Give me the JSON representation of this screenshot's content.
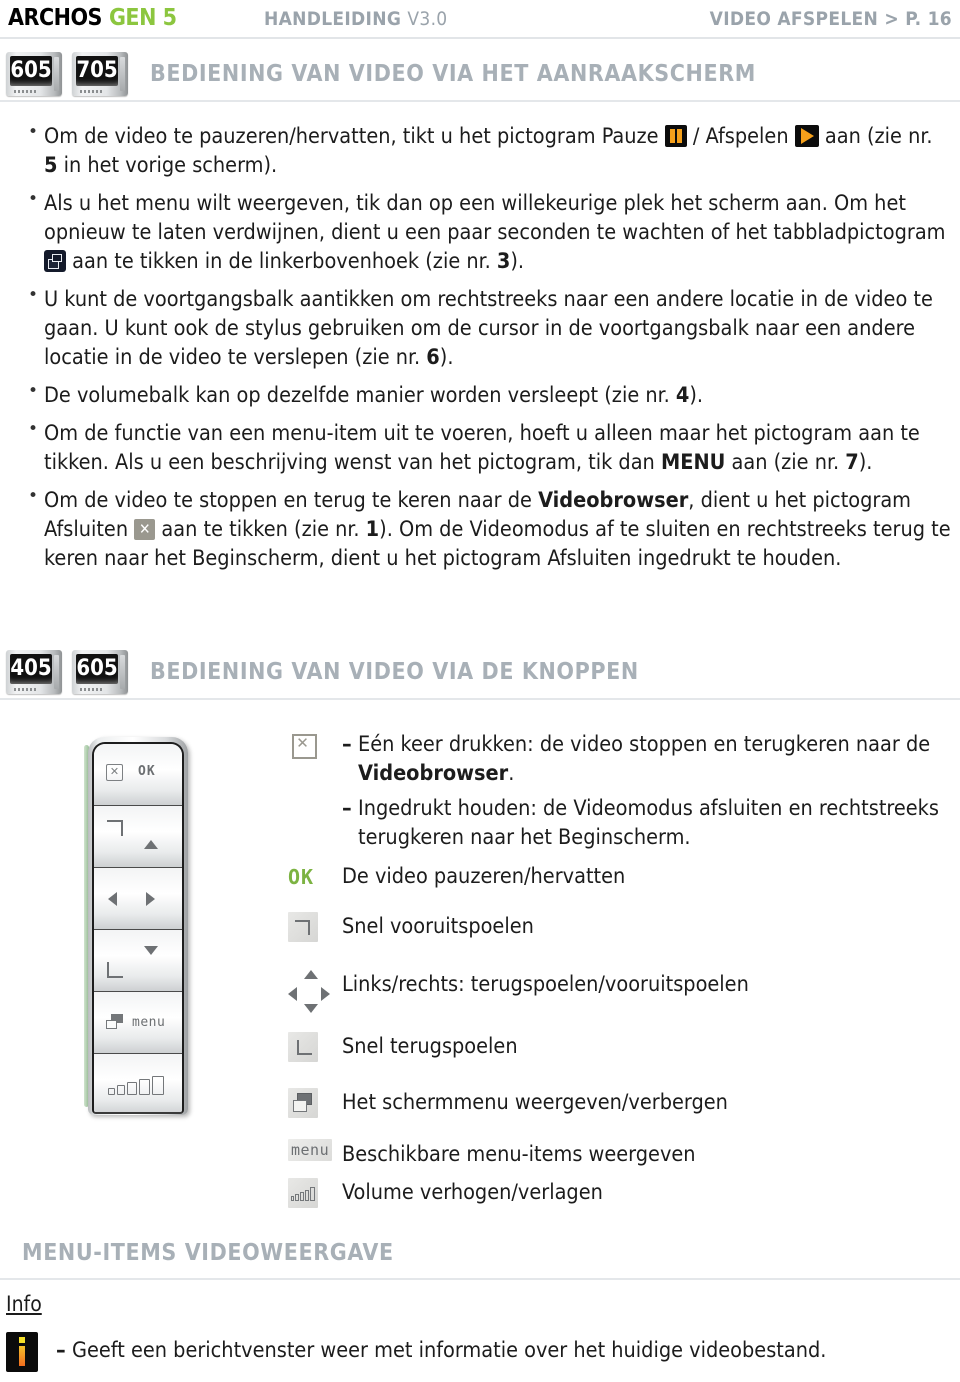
{
  "header": {
    "brand_archos": "ARCHOS",
    "brand_gen": "GEN 5",
    "manual": "HANDLEIDING",
    "version": "V3.0",
    "breadcrumb": "VIDEO AFSPELEN >",
    "page": "P. 16",
    "accent_green": "#8cc63f",
    "muted_gray": "#9aa3ab"
  },
  "section1": {
    "badges": [
      "605",
      "705"
    ],
    "title": "BEDIENING VAN VIDEO VIA HET AANRAAKSCHERM",
    "bullets": [
      {
        "id": "pauze-afspelen",
        "parts": [
          {
            "t": "text",
            "v": "Om de video te pauzeren/hervatten, tikt u het pictogram Pauze "
          },
          {
            "t": "icon",
            "v": "pause-icon"
          },
          {
            "t": "text",
            "v": " / Afspelen "
          },
          {
            "t": "icon",
            "v": "play-icon"
          },
          {
            "t": "text",
            "v": " aan (zie nr. "
          },
          {
            "t": "num",
            "v": "5"
          },
          {
            "t": "text",
            "v": " in het vorige scherm)."
          }
        ]
      },
      {
        "id": "menu-weergeven",
        "parts": [
          {
            "t": "text",
            "v": "Als u het menu wilt weergeven, tik dan op een willekeurige plek het scherm aan. Om het opnieuw te laten verdwijnen, dient u een paar seconden te wachten of het tabbladpictogram "
          },
          {
            "t": "icon",
            "v": "tab-icon"
          },
          {
            "t": "text",
            "v": " aan te tikken in de linkerbovenhoek (zie nr. "
          },
          {
            "t": "num",
            "v": "3"
          },
          {
            "t": "text",
            "v": ")."
          }
        ]
      },
      {
        "id": "voortgangsbalk",
        "parts": [
          {
            "t": "text",
            "v": "U kunt de voortgangsbalk aantikken om rechtstreeks naar een andere locatie in de video te gaan. U kunt ook de stylus gebruiken om de cursor in de voortgangsbalk naar een andere locatie in de video te verslepen (zie nr. "
          },
          {
            "t": "num",
            "v": "6"
          },
          {
            "t": "text",
            "v": ")."
          }
        ]
      },
      {
        "id": "volumebalk",
        "parts": [
          {
            "t": "text",
            "v": "De volumebalk kan op dezelfde manier worden versleept (zie nr. "
          },
          {
            "t": "num",
            "v": "4"
          },
          {
            "t": "text",
            "v": ")."
          }
        ]
      },
      {
        "id": "menu-item-functie",
        "parts": [
          {
            "t": "text",
            "v": "Om de functie van een menu-item uit te voeren, hoeft u alleen maar het pictogram aan te tikken. Als u een beschrijving wenst van het pictogram, tik dan "
          },
          {
            "t": "bold",
            "v": "MENU"
          },
          {
            "t": "text",
            "v": " aan (zie nr. "
          },
          {
            "t": "num",
            "v": "7"
          },
          {
            "t": "text",
            "v": ")."
          }
        ]
      },
      {
        "id": "video-stoppen",
        "parts": [
          {
            "t": "text",
            "v": "Om de video te stoppen en terug te keren naar de "
          },
          {
            "t": "bold",
            "v": "Videobrowser"
          },
          {
            "t": "text",
            "v": ", dient u het pictogram Afsluiten "
          },
          {
            "t": "icon",
            "v": "exit-x-icon"
          },
          {
            "t": "text",
            "v": " aan te tikken (zie nr. "
          },
          {
            "t": "num",
            "v": "1"
          },
          {
            "t": "text",
            "v": "). Om de Videomodus af te sluiten en rechtstreeks terug te keren naar het Beginscherm, dient u het pictogram Afsluiten ingedrukt te houden."
          }
        ]
      }
    ]
  },
  "section2": {
    "badges": [
      "405",
      "605"
    ],
    "title": "BEDIENING VAN VIDEO VIA DE KNOPPEN",
    "device": {
      "name": "archos-remote-control",
      "buttons": [
        {
          "id": "ok-row",
          "labels": [
            "X",
            "OK"
          ]
        },
        {
          "id": "fast-forward-up-row",
          "labels": [
            "fast-forward",
            "up-arrow"
          ]
        },
        {
          "id": "left-right-row",
          "labels": [
            "left-arrow",
            "right-arrow"
          ]
        },
        {
          "id": "down-rewind-row",
          "labels": [
            "down-arrow",
            "rewind"
          ]
        },
        {
          "id": "menu-row",
          "labels": [
            "menu-glyph",
            "menu"
          ]
        },
        {
          "id": "volume-row",
          "labels": [
            "volume-bars"
          ]
        }
      ],
      "menu_word": "menu",
      "ok_word": "OK"
    },
    "legend": [
      {
        "icon": "exit-x-icon",
        "lines": [
          {
            "dash": true,
            "parts": [
              {
                "t": "text",
                "v": "Eén keer drukken: de video stoppen en terugkeren naar de "
              },
              {
                "t": "bold",
                "v": "Videobrowser"
              },
              {
                "t": "text",
                "v": "."
              }
            ]
          },
          {
            "dash": true,
            "parts": [
              {
                "t": "text",
                "v": "Ingedrukt houden: de Videomodus afsluiten en rechtstreeks terugkeren naar het Beginscherm."
              }
            ]
          }
        ]
      },
      {
        "icon": "ok-icon",
        "icon_text": "OK",
        "lines": [
          {
            "dash": false,
            "parts": [
              {
                "t": "text",
                "v": "De video pauzeren/hervatten"
              }
            ]
          }
        ]
      },
      {
        "icon": "fast-forward-icon",
        "lines": [
          {
            "dash": false,
            "parts": [
              {
                "t": "text",
                "v": "Snel vooruitspoelen"
              }
            ]
          }
        ]
      },
      {
        "icon": "dpad-icon",
        "lines": [
          {
            "dash": false,
            "parts": [
              {
                "t": "text",
                "v": "Links/rechts: terugspoelen/vooruitspoelen"
              }
            ]
          }
        ]
      },
      {
        "icon": "rewind-icon",
        "lines": [
          {
            "dash": false,
            "parts": [
              {
                "t": "text",
                "v": "Snel terugspoelen"
              }
            ]
          }
        ]
      },
      {
        "icon": "screen-menu-icon",
        "lines": [
          {
            "dash": false,
            "parts": [
              {
                "t": "text",
                "v": "Het schermmenu weergeven/verbergen"
              }
            ]
          }
        ]
      },
      {
        "icon": "menu-text-icon",
        "icon_text": "menu",
        "lines": [
          {
            "dash": false,
            "parts": [
              {
                "t": "text",
                "v": "Beschikbare menu-items weergeven"
              }
            ]
          }
        ]
      },
      {
        "icon": "volume-icon",
        "lines": [
          {
            "dash": false,
            "parts": [
              {
                "t": "text",
                "v": "Volume verhogen/verlagen"
              }
            ]
          }
        ]
      }
    ]
  },
  "section3": {
    "title": "MENU-ITEMS VIDEOWEERGAVE",
    "sub_label": "Info",
    "info_text": "Geeft een berichtvenster weer met informatie over het huidige videobestand."
  }
}
